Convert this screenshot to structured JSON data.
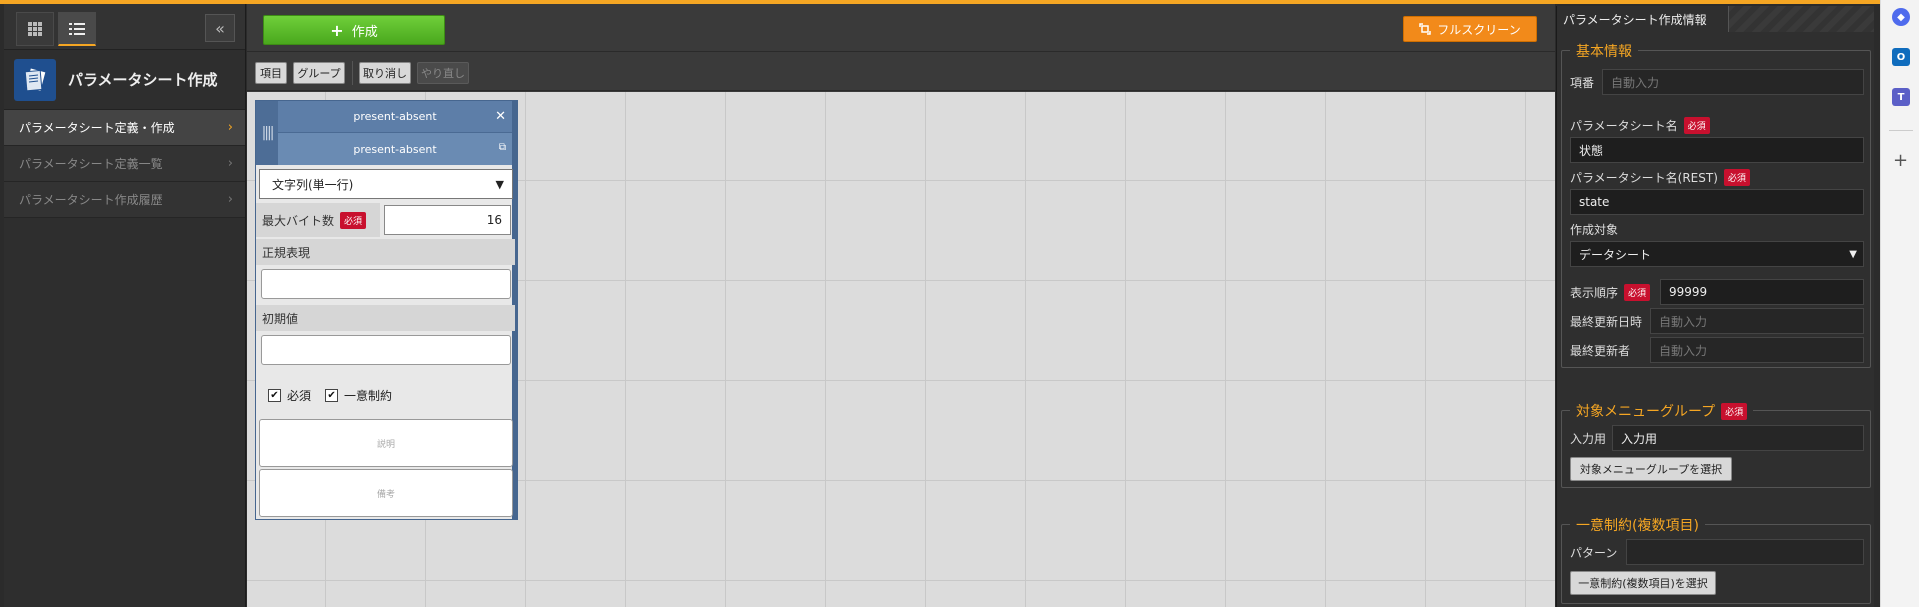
{
  "sidebar": {
    "title": "パラメータシート作成",
    "items": [
      {
        "label": "パラメータシート定義・作成",
        "active": true
      },
      {
        "label": "パラメータシート定義一覧",
        "active": false
      },
      {
        "label": "パラメータシート作成履歴",
        "active": false
      }
    ]
  },
  "header": {
    "create_label": "作成",
    "fullscreen_label": "フルスクリーン"
  },
  "toolbar": {
    "item_label": "項目",
    "group_label": "グループ",
    "undo_label": "取り消し",
    "redo_label": "やり直し"
  },
  "card": {
    "name": "present-absent",
    "name_rest": "present-absent",
    "type_value": "文字列(単一行)",
    "max_bytes_label": "最大バイト数",
    "max_bytes_value": "16",
    "required_badge": "必須",
    "regex_label": "正規表現",
    "default_label": "初期値",
    "required_check_label": "必須",
    "unique_check_label": "一意制約",
    "description_placeholder": "説明",
    "remarks_placeholder": "備考"
  },
  "panel": {
    "tab_label": "パラメータシート作成情報",
    "basic": {
      "legend": "基本情報",
      "number_label": "項番",
      "number_placeholder": "自動入力",
      "name_label": "パラメータシート名",
      "name_value": "状態",
      "rest_label": "パラメータシート名(REST)",
      "rest_value": "state",
      "target_label": "作成対象",
      "target_value": "データシート",
      "order_label": "表示順序",
      "order_value": "99999",
      "updated_at_label": "最終更新日時",
      "updated_at_placeholder": "自動入力",
      "updated_by_label": "最終更新者",
      "updated_by_placeholder": "自動入力",
      "required_badge": "必須"
    },
    "menu_group": {
      "legend": "対象メニューグループ",
      "input_label": "入力用",
      "input_value": "入力用",
      "select_button": "対象メニューグループを選択",
      "required_badge": "必須"
    },
    "unique": {
      "legend": "一意制約(複数項目)",
      "pattern_label": "パターン",
      "select_button": "一意制約(複数項目)を選択"
    }
  },
  "colors": {
    "accent": "#f5a623",
    "create_green": "#4aa81d",
    "fullscreen_orange": "#f28a1a",
    "card_blue": "#5d7ea8",
    "required_red": "#c8102e"
  }
}
